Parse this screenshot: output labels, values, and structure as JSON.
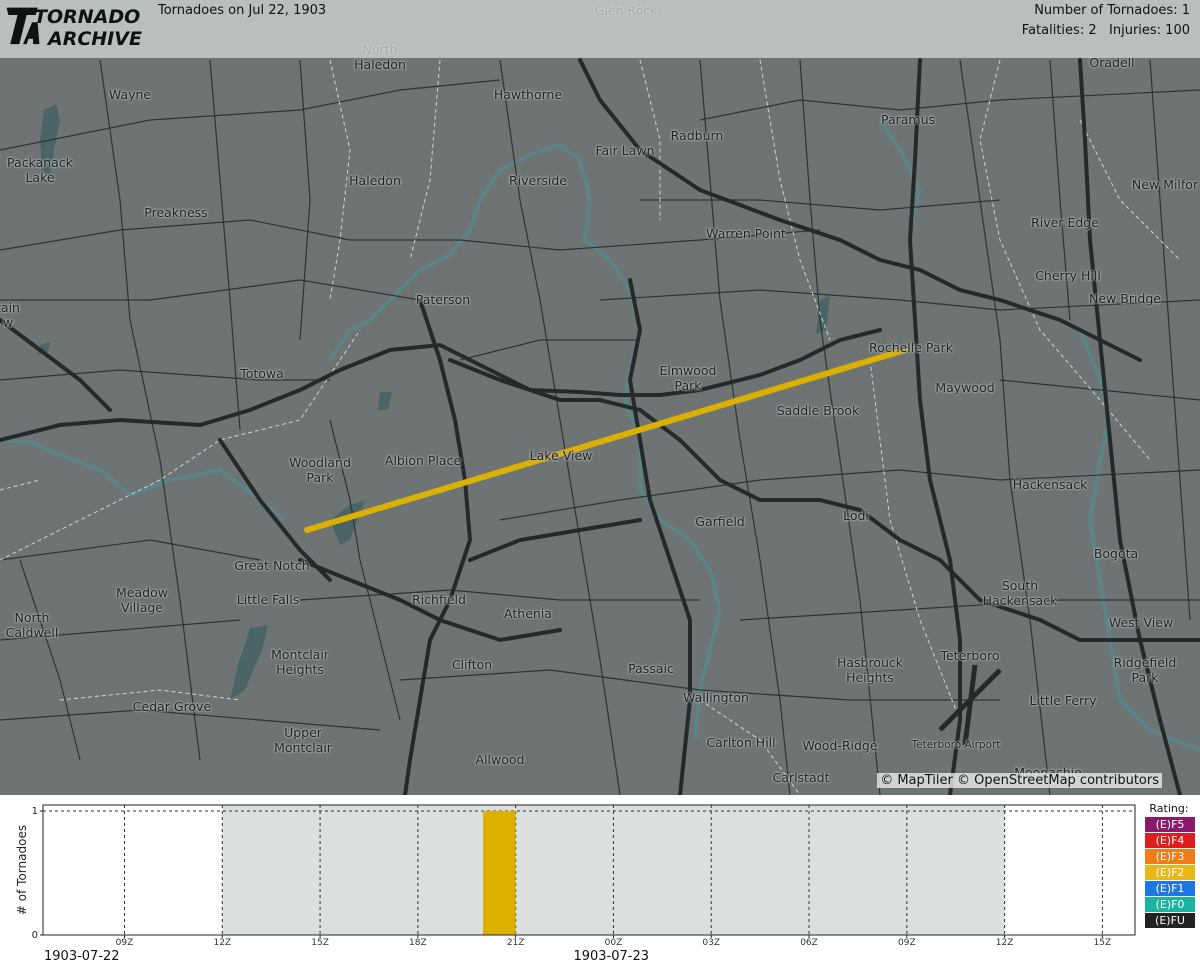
{
  "header": {
    "logo_text": "TA TORNADO ARCHIVE",
    "title": "Tornadoes on Jul 22, 1903",
    "count_label": "Number of Tornadoes: 1",
    "fatalities_label": "Fatalities: 2",
    "injuries_label": "Injuries: 100"
  },
  "map": {
    "attribution": "© MapTiler © OpenStreetMap contributors",
    "place_labels": [
      {
        "name": "Glen Rock",
        "lines": [
          "Glen Rock"
        ]
      },
      {
        "name": "North Haledon",
        "lines": [
          "North",
          "Haledon"
        ]
      },
      {
        "name": "Oradell",
        "lines": [
          "Oradell"
        ]
      },
      {
        "name": "Wayne",
        "lines": [
          "Wayne"
        ]
      },
      {
        "name": "Hawthorne",
        "lines": [
          "Hawthorne"
        ]
      },
      {
        "name": "Paramus",
        "lines": [
          "Paramus"
        ]
      },
      {
        "name": "Radburn",
        "lines": [
          "Radburn"
        ]
      },
      {
        "name": "Packanack Lake",
        "lines": [
          "Packanack",
          "Lake"
        ]
      },
      {
        "name": "Fair Lawn",
        "lines": [
          "Fair Lawn"
        ]
      },
      {
        "name": "Haledon",
        "lines": [
          "Haledon"
        ]
      },
      {
        "name": "Riverside",
        "lines": [
          "Riverside"
        ]
      },
      {
        "name": "New Milford",
        "lines": [
          "New Milfor"
        ]
      },
      {
        "name": "Preakness",
        "lines": [
          "Preakness"
        ]
      },
      {
        "name": "River Edge",
        "lines": [
          "River Edge"
        ]
      },
      {
        "name": "Warren Point",
        "lines": [
          "Warren Point"
        ]
      },
      {
        "name": "Cherry Hill",
        "lines": [
          "Cherry Hill"
        ]
      },
      {
        "name": "Paterson",
        "lines": [
          "Paterson"
        ]
      },
      {
        "name": "New Bridge",
        "lines": [
          "New Bridge"
        ]
      },
      {
        "name": "Mountain View",
        "lines": [
          "tain",
          "w"
        ]
      },
      {
        "name": "Rochelle Park",
        "lines": [
          "Rochelle Park"
        ]
      },
      {
        "name": "Elmwood Park",
        "lines": [
          "Elmwood",
          "Park"
        ]
      },
      {
        "name": "Totowa",
        "lines": [
          "Totowa"
        ]
      },
      {
        "name": "Maywood",
        "lines": [
          "Maywood"
        ]
      },
      {
        "name": "Saddle Brook",
        "lines": [
          "Saddle Brook"
        ]
      },
      {
        "name": "Lake View",
        "lines": [
          "Lake View"
        ]
      },
      {
        "name": "Woodland Park",
        "lines": [
          "Woodland",
          "Park"
        ]
      },
      {
        "name": "Albion Place",
        "lines": [
          "Albion Place"
        ]
      },
      {
        "name": "Hackensack",
        "lines": [
          "Hackensack"
        ]
      },
      {
        "name": "Lodi",
        "lines": [
          "Lodi"
        ]
      },
      {
        "name": "Garfield",
        "lines": [
          "Garfield"
        ]
      },
      {
        "name": "Bogota",
        "lines": [
          "Bogota"
        ]
      },
      {
        "name": "Great Notch",
        "lines": [
          "Great Notch"
        ]
      },
      {
        "name": "South Hackensack",
        "lines": [
          "South",
          "Hackensack"
        ]
      },
      {
        "name": "Meadow Village",
        "lines": [
          "Meadow",
          "Village"
        ]
      },
      {
        "name": "Little Falls",
        "lines": [
          "Little Falls"
        ]
      },
      {
        "name": "Richfield",
        "lines": [
          "Richfield"
        ]
      },
      {
        "name": "Athenia",
        "lines": [
          "Athenia"
        ]
      },
      {
        "name": "North Caldwell",
        "lines": [
          "North",
          "Caldwell"
        ]
      },
      {
        "name": "West View",
        "lines": [
          "West View"
        ]
      },
      {
        "name": "Teterboro",
        "lines": [
          "Teterboro"
        ]
      },
      {
        "name": "Ridgefield Park",
        "lines": [
          "Ridgefield",
          "Park"
        ]
      },
      {
        "name": "Montclair Heights",
        "lines": [
          "Montclair",
          "Heights"
        ]
      },
      {
        "name": "Clifton",
        "lines": [
          "Clifton"
        ]
      },
      {
        "name": "Passaic",
        "lines": [
          "Passaic"
        ]
      },
      {
        "name": "Hasbrouck Heights",
        "lines": [
          "Hasbrouck",
          "Heights"
        ]
      },
      {
        "name": "Wallington",
        "lines": [
          "Wallington"
        ]
      },
      {
        "name": "Little Ferry",
        "lines": [
          "Little Ferry"
        ]
      },
      {
        "name": "Cedar Grove",
        "lines": [
          "Cedar Grove"
        ]
      },
      {
        "name": "Upper Montclair",
        "lines": [
          "Upper",
          "Montclair"
        ]
      },
      {
        "name": "Teterboro Airport",
        "lines": [
          "Teterboro Airport"
        ]
      },
      {
        "name": "Carlton Hill",
        "lines": [
          "Carlton Hill"
        ]
      },
      {
        "name": "Wood-Ridge",
        "lines": [
          "Wood-Ridge"
        ]
      },
      {
        "name": "Allwood",
        "lines": [
          "Allwood"
        ]
      },
      {
        "name": "Carlstadt",
        "lines": [
          "Carlstadt"
        ]
      },
      {
        "name": "Moonachie",
        "lines": [
          "Moonachie"
        ]
      }
    ],
    "track_color": "#dcb000"
  },
  "chart_data": {
    "type": "bar",
    "ylabel": "# of Tornadoes",
    "yticks": [
      "0",
      "1"
    ],
    "ylim": [
      0,
      1
    ],
    "x_ticks": [
      "09Z",
      "12Z",
      "15Z",
      "18Z",
      "21Z",
      "00Z",
      "03Z",
      "06Z",
      "09Z",
      "12Z",
      "15Z"
    ],
    "date_labels": [
      "1903-07-22",
      "1903-07-23"
    ],
    "day_window": {
      "start": "1903-07-22 12Z",
      "end": "1903-07-23 12Z"
    },
    "series": [
      {
        "rating": "(E)F2",
        "color": "#dcb000",
        "bins": [
          {
            "start": "1903-07-22 20Z",
            "end": "1903-07-22 21Z",
            "count": 1
          }
        ]
      }
    ]
  },
  "legend": {
    "title": "Rating:",
    "items": [
      {
        "label": "(E)F5",
        "color": "#8a1a6e"
      },
      {
        "label": "(E)F4",
        "color": "#e01c1c"
      },
      {
        "label": "(E)F3",
        "color": "#f07c1a"
      },
      {
        "label": "(E)F2",
        "color": "#e8b818"
      },
      {
        "label": "(E)F1",
        "color": "#1c78e0"
      },
      {
        "label": "(E)F0",
        "color": "#18b4a0"
      },
      {
        "label": "(E)FU",
        "color": "#222222"
      }
    ]
  }
}
